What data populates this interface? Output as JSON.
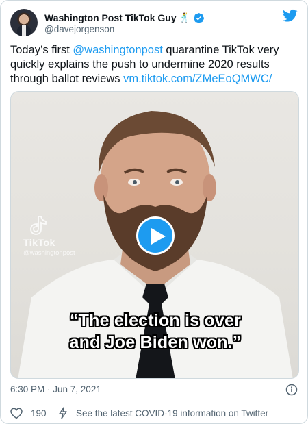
{
  "author": {
    "display_name": "Washington Post TikTok Guy",
    "emoji": "🕺",
    "handle": "@davejorgenson"
  },
  "tweet": {
    "text_before": "Today’s first ",
    "mention": "@washingtonpost",
    "text_after": " quarantine TikTok very quickly explains the push to undermine 2020 results through ballot reviews ",
    "link": "vm.tiktok.com/ZMeEoQMWC/"
  },
  "video": {
    "watermark_name": "TikTok",
    "watermark_user": "@washingtonpost",
    "caption_line1": "“The election is over",
    "caption_line2": "and Joe Biden won.”"
  },
  "meta": {
    "timestamp": "6:30 PM · Jun 7, 2021"
  },
  "actions": {
    "like_count": "190",
    "covid_info": "See the latest COVID-19 information on Twitter"
  },
  "colors": {
    "accent": "#1d9bf0",
    "secondary_text": "#536471",
    "border": "#cfd9de"
  },
  "icons": [
    "verified-badge-icon",
    "twitter-bird-icon",
    "play-icon",
    "info-icon",
    "heart-icon",
    "lightning-icon",
    "tiktok-logo-icon"
  ]
}
